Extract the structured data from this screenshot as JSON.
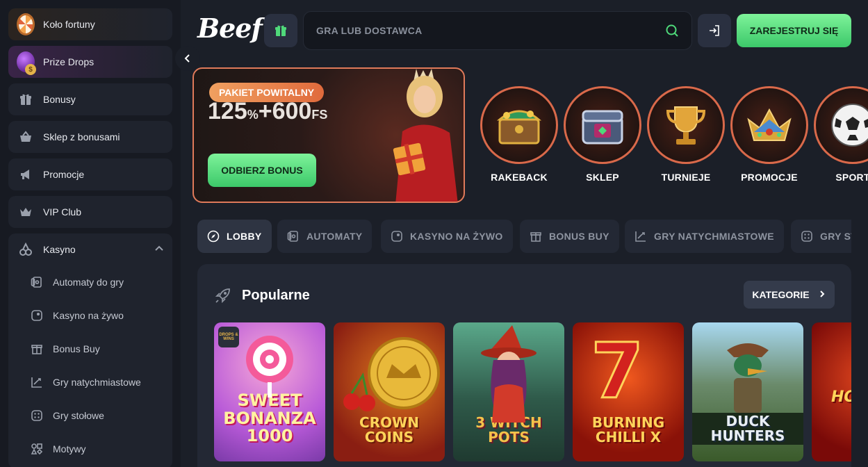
{
  "sidebar": {
    "items": [
      {
        "label": "Koło fortuny"
      },
      {
        "label": "Prize Drops"
      },
      {
        "label": "Bonusy"
      },
      {
        "label": "Sklep z bonusami"
      },
      {
        "label": "Promocje"
      },
      {
        "label": "VIP Club"
      }
    ],
    "kasyno": {
      "label": "Kasyno",
      "expanded": true,
      "sub_items": [
        {
          "label": "Automaty do gry"
        },
        {
          "label": "Kasyno na żywo"
        },
        {
          "label": "Bonus Buy"
        },
        {
          "label": "Gry natychmiastowe"
        },
        {
          "label": "Gry stołowe"
        },
        {
          "label": "Motywy"
        }
      ]
    }
  },
  "header": {
    "logo": "Beef",
    "search_placeholder": "GRA LUB DOSTAWCA",
    "register_label": "ZAREJESTRUJ SIĘ"
  },
  "promo": {
    "tag": "PAKIET POWITALNY",
    "amount_main": "125",
    "amount_pct": "%",
    "amount_plus": "+600",
    "amount_fs": "FS",
    "button": "ODBIERZ BONUS"
  },
  "categories": [
    {
      "label": "RAKEBACK"
    },
    {
      "label": "SKLEP"
    },
    {
      "label": "TURNIEJE"
    },
    {
      "label": "PROMOCJE"
    },
    {
      "label": "SPORT"
    }
  ],
  "tabs": [
    {
      "label": "LOBBY",
      "active": true
    },
    {
      "label": "AUTOMATY"
    },
    {
      "label": "KASYNO NA ŻYWO"
    },
    {
      "label": "BONUS BUY"
    },
    {
      "label": "GRY NATYCHMIASTOWE"
    },
    {
      "label": "GRY STOŁOWE"
    }
  ],
  "popular": {
    "title": "Popularne",
    "button": "KATEGORIE",
    "games": [
      {
        "title_line1": "SWEET",
        "title_line2": "BONANZA",
        "title_line3": "1000",
        "badge": "DROPS & WINS"
      },
      {
        "title_line1": "CROWN",
        "title_line2": "COINS"
      },
      {
        "title_line1": "3 WITCH POTS"
      },
      {
        "title_line1": "BURNING",
        "title_line2": "CHILLI X"
      },
      {
        "title_line1": "DUCK HUNTERS"
      },
      {
        "title_line1": "HOT"
      }
    ]
  },
  "colors": {
    "accent_green": "#4fd97a",
    "promo_border": "#e07a5a",
    "background": "#1b1f28"
  }
}
